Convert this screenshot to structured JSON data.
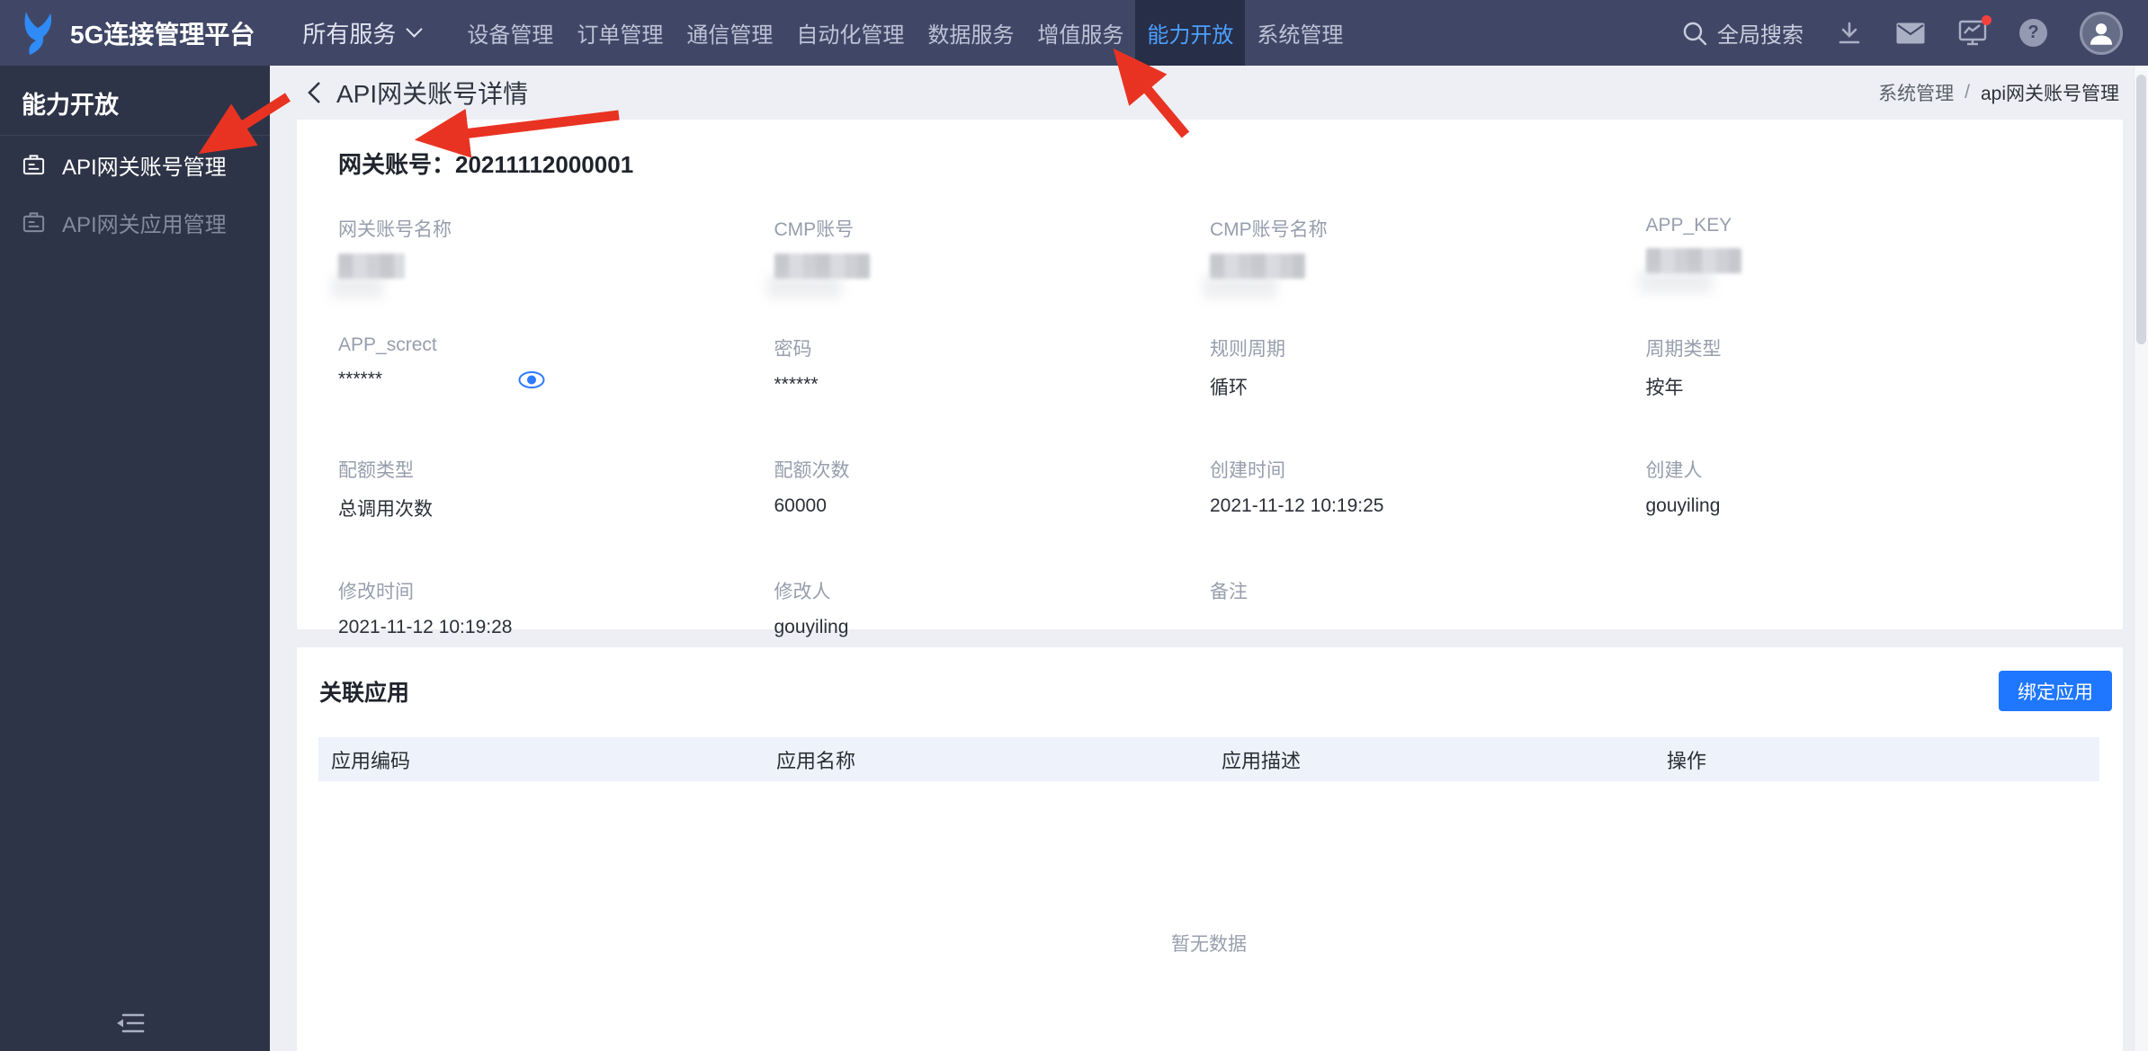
{
  "topbar": {
    "logo_title": "5G连接管理平台",
    "nav": [
      {
        "label": "所有服务",
        "has_dropdown": true,
        "active": false
      },
      {
        "label": "设备管理",
        "active": false
      },
      {
        "label": "订单管理",
        "active": false
      },
      {
        "label": "通信管理",
        "active": false
      },
      {
        "label": "自动化管理",
        "active": false
      },
      {
        "label": "数据服务",
        "active": false
      },
      {
        "label": "增值服务",
        "active": false
      },
      {
        "label": "能力开放",
        "active": true
      },
      {
        "label": "系统管理",
        "active": false
      }
    ],
    "search_label": "全局搜索",
    "help_glyph": "?",
    "icons": [
      "search-icon",
      "download-icon",
      "mail-icon",
      "monitor-icon",
      "help-icon",
      "avatar"
    ],
    "monitor_has_badge": true
  },
  "sidebar": {
    "title": "能力开放",
    "items": [
      {
        "label": "API网关账号管理",
        "active": true
      },
      {
        "label": "API网关应用管理",
        "active": false
      }
    ]
  },
  "page": {
    "back_title": "API网关账号详情",
    "breadcrumb": [
      "系统管理",
      "api网关账号管理"
    ],
    "breadcrumb_separator": "/"
  },
  "detail": {
    "heading_label": "网关账号：",
    "heading_value": "20211112000001",
    "fields": [
      {
        "label": "网关账号名称",
        "value": "",
        "redacted": true
      },
      {
        "label": "CMP账号",
        "value": "",
        "redacted": true
      },
      {
        "label": "CMP账号名称",
        "value": "",
        "redacted": true
      },
      {
        "label": "APP_KEY",
        "value": "",
        "redacted": true
      },
      {
        "label": "APP_screct",
        "value": "******",
        "eye": true
      },
      {
        "label": "密码",
        "value": "******"
      },
      {
        "label": "规则周期",
        "value": "循环"
      },
      {
        "label": "周期类型",
        "value": "按年"
      },
      {
        "label": "配额类型",
        "value": "总调用次数"
      },
      {
        "label": "配额次数",
        "value": "60000"
      },
      {
        "label": "创建时间",
        "value": "2021-11-12 10:19:25"
      },
      {
        "label": "创建人",
        "value": "gouyiling"
      },
      {
        "label": "修改时间",
        "value": "2021-11-12 10:19:28"
      },
      {
        "label": "修改人",
        "value": "gouyiling"
      },
      {
        "label": "备注",
        "value": ""
      }
    ]
  },
  "related": {
    "title": "关联应用",
    "bind_button": "绑定应用",
    "columns": [
      "应用编码",
      "应用名称",
      "应用描述",
      "操作"
    ],
    "empty_text": "暂无数据"
  },
  "colors": {
    "topbar_bg": "#404766",
    "sidebar_bg": "#2e3447",
    "nav_active_text": "#4ba0ff",
    "accent_blue": "#1f77ff",
    "table_header_bg": "#eef2fb",
    "arrow_red": "#e93322",
    "eye_blue": "#2f7bff"
  }
}
